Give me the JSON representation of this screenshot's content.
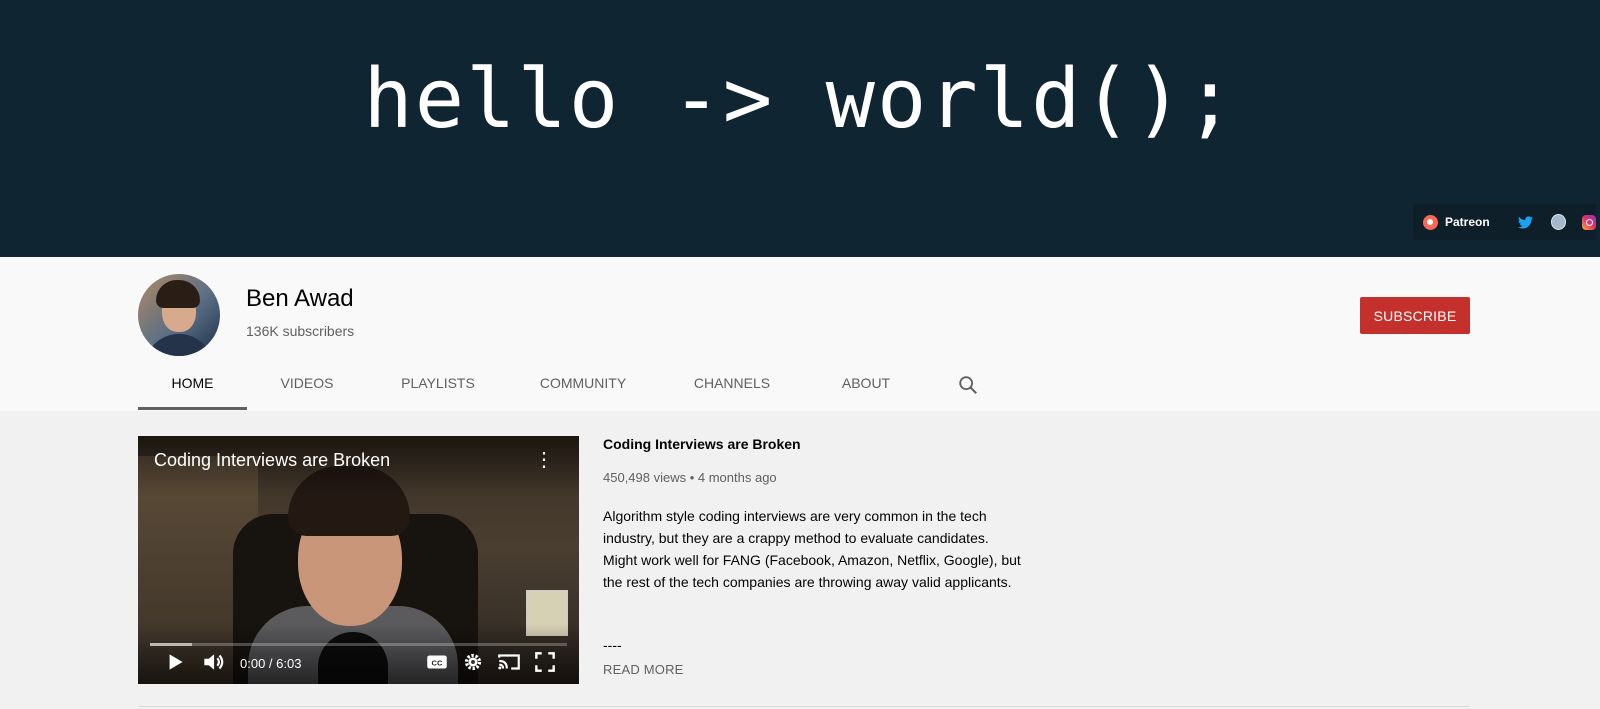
{
  "banner": {
    "text": "hello -> world();",
    "links": {
      "patreon_label": "Patreon",
      "icons": [
        "patreon-icon",
        "twitter-icon",
        "globe-icon",
        "instagram-icon"
      ]
    }
  },
  "channel": {
    "name": "Ben Awad",
    "subscribers": "136K subscribers",
    "subscribe_label": "SUBSCRIBE"
  },
  "tabs": [
    {
      "label": "HOME",
      "active": true
    },
    {
      "label": "VIDEOS",
      "active": false
    },
    {
      "label": "PLAYLISTS",
      "active": false
    },
    {
      "label": "COMMUNITY",
      "active": false
    },
    {
      "label": "CHANNELS",
      "active": false
    },
    {
      "label": "ABOUT",
      "active": false
    }
  ],
  "featured": {
    "player": {
      "title": "Coding Interviews are Broken",
      "time": "0:00 / 6:03",
      "buffered_fraction": 0.1,
      "controls": [
        "play-icon",
        "volume-icon",
        "captions-icon",
        "settings-icon",
        "cast-icon",
        "fullscreen-icon"
      ]
    },
    "info": {
      "title": "Coding Interviews are Broken",
      "meta": "450,498 views • 4 months ago",
      "description": "Algorithm style coding interviews are very common in the tech industry, but they are a crappy method to evaluate candidates. Might work well for FANG (Facebook, Amazon, Netflix, Google), but the rest of the tech companies are throwing away valid applicants.",
      "dash": "----",
      "read_more": "READ MORE"
    }
  },
  "colors": {
    "banner_bg": "#0f2531",
    "subscribe_red": "#c4302b",
    "page_bg": "#f1f1f1",
    "header_bg": "#f9f9f9"
  }
}
